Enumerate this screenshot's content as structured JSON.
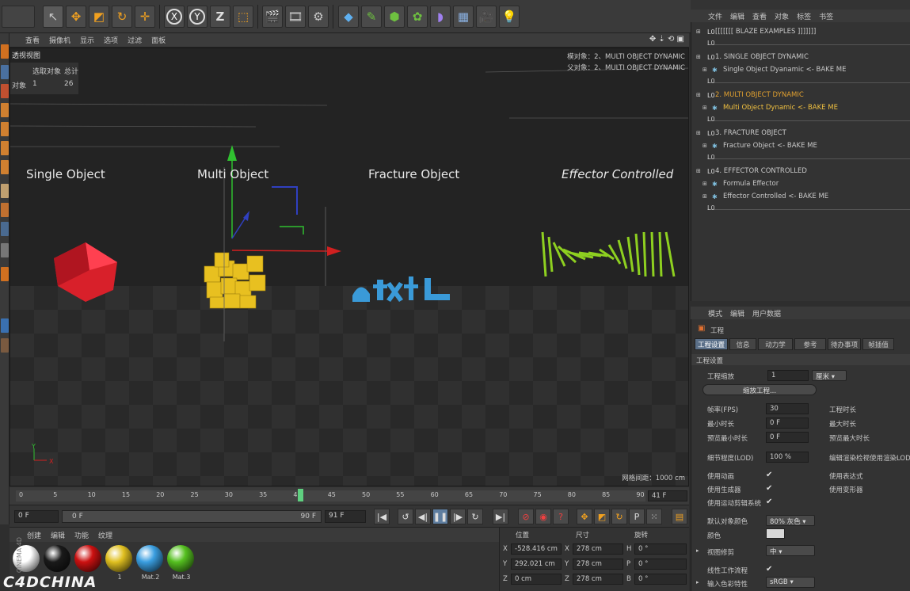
{
  "top_toolbar": {
    "icons": [
      "pointer-icon",
      "move-icon",
      "scale-icon",
      "rotate-icon",
      "add-icon",
      "x-axis-icon",
      "y-axis-icon",
      "z-axis-icon",
      "coord-system-icon",
      "render-view-icon",
      "render-picture-viewer-icon",
      "render-settings-icon",
      "cube-icon",
      "pen-icon",
      "subdivision-icon",
      "array-icon",
      "deformer-icon",
      "floor-icon",
      "camera-icon",
      "light-icon"
    ],
    "z_label": "Z"
  },
  "viewport": {
    "menu": [
      "查看",
      "摄像机",
      "显示",
      "选项",
      "过滤",
      "面板"
    ],
    "view_name": "透视视图",
    "hud_header_selected": "选取对象",
    "hud_header_total": "总计",
    "hud_row_label": "对象",
    "hud_row_selected": "1",
    "hud_row_total": "26",
    "hud_obj_line": "模对象：2、MULTI OBJECT DYNAMIC",
    "hud_obj_line2": "父对象：2、MULTI OBJECT DYNAMIC",
    "label1": "Single Object",
    "label2": "Multi Object",
    "label3": "Fracture Object",
    "label4": "Effector Controlled",
    "grid_spacing": "网格间距：1000 cm",
    "axis_y": "Y",
    "axis_x": "X"
  },
  "timeline": {
    "ticks": [
      "0",
      "5",
      "10",
      "15",
      "20",
      "25",
      "30",
      "35",
      "40",
      "45",
      "50",
      "55",
      "60",
      "65",
      "70",
      "75",
      "80",
      "85",
      "90"
    ],
    "current_frame": "41 F",
    "start_field": "0 F",
    "range_start": "0 F",
    "range_end": "90 F",
    "end_field": "91 F"
  },
  "materials": {
    "menu": [
      "创建",
      "编辑",
      "功能",
      "纹理"
    ],
    "items": [
      {
        "name": "",
        "color": "#ffffff"
      },
      {
        "name": "",
        "color": "#1a1a1a"
      },
      {
        "name": "",
        "color": "#cc1111"
      },
      {
        "name": "1",
        "color": "#e0c020"
      },
      {
        "name": "Mat.2",
        "color": "#3a9ee0"
      },
      {
        "name": "Mat.3",
        "color": "#55c020"
      }
    ],
    "watermark": "C4DCHINA",
    "side_label": "CINEMA 4D"
  },
  "coords": {
    "headers": [
      "位置",
      "尺寸",
      "旋转"
    ],
    "rows": [
      {
        "axis": "X",
        "pos": "-528.416 cm",
        "size_axis": "X",
        "size": "278 cm",
        "rot_axis": "H",
        "rot": "0 °"
      },
      {
        "axis": "Y",
        "pos": "292.021 cm",
        "size_axis": "Y",
        "size": "278 cm",
        "rot_axis": "P",
        "rot": "0 °"
      },
      {
        "axis": "Z",
        "pos": "0 cm",
        "size_axis": "Z",
        "size": "278 cm",
        "rot_axis": "B",
        "rot": "0 °"
      }
    ]
  },
  "object_manager": {
    "menu": [
      "文件",
      "编辑",
      "查看",
      "对象",
      "标签",
      "书签"
    ],
    "rows": [
      {
        "text": "[[[[[[[    BLAZE EXAMPLES    ]]]]]]]",
        "indent": 0,
        "color": "#c8c8c8"
      },
      {
        "text": "1.  SINGLE OBJECT DYNAMIC",
        "indent": 0,
        "color": "#c8c8c8"
      },
      {
        "text": "Single Object Dyanamic <- BAKE ME",
        "indent": 1,
        "color": "#c8c8c8"
      },
      {
        "text": "2.  MULTI OBJECT DYNAMIC",
        "indent": 0,
        "color": "#e0a030"
      },
      {
        "text": "Multi Object Dynamic <- BAKE ME",
        "indent": 1,
        "color": "#f0c040"
      },
      {
        "text": "3.  FRACTURE OBJECT",
        "indent": 0,
        "color": "#c8c8c8"
      },
      {
        "text": "Fracture Object <- BAKE ME",
        "indent": 1,
        "color": "#c8c8c8"
      },
      {
        "text": "4.  EFFECTOR CONTROLLED",
        "indent": 0,
        "color": "#c8c8c8"
      },
      {
        "text": "Formula Effector",
        "indent": 1,
        "color": "#c8c8c8"
      },
      {
        "text": "Effector Controlled <- BAKE ME",
        "indent": 1,
        "color": "#c8c8c8"
      }
    ]
  },
  "attributes": {
    "menu": [
      "模式",
      "编辑",
      "用户数据"
    ],
    "title": "工程",
    "tabs": [
      "工程设置",
      "信息",
      "动力学",
      "参考",
      "待办事项",
      "帧插值"
    ],
    "section": "工程设置",
    "scale_label": "工程缩放",
    "scale_value": "1",
    "scale_unit": "厘米",
    "scale_button": "缩放工程...",
    "fps_label": "帧率(FPS)",
    "fps_value": "30",
    "project_time_label": "工程时长",
    "min_time_label": "最小时长",
    "min_time_value": "0 F",
    "max_time_label": "最大时长",
    "preview_min_label": "预览最小时长",
    "preview_min_value": "0 F",
    "preview_max_label": "预览最大时长",
    "lod_label": "细节程度(LOD)",
    "lod_value": "100 %",
    "lod_right": "编辑渲染检视使用渲染LOD",
    "use_anim_label": "使用动画",
    "use_expr_label": "使用表达式",
    "use_gen_label": "使用生成器",
    "use_deform_label": "使用变形器",
    "use_motion_label": "使用运动剪辑系统",
    "default_color_label": "默认对象颜色",
    "default_color_value": "80% 灰色",
    "color_label": "颜色",
    "view_clip_label": "视图修剪",
    "view_clip_value": "中",
    "linear_label": "线性工作流程",
    "input_color_label": "输入色彩特性",
    "input_color_value": "sRGB",
    "check": "✔"
  }
}
